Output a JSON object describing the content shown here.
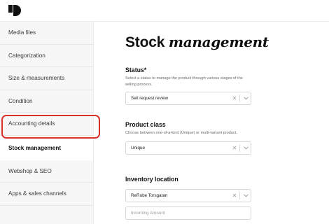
{
  "sidebar": {
    "items": [
      {
        "label": "Media files"
      },
      {
        "label": "Categorization"
      },
      {
        "label": "Size & measurements"
      },
      {
        "label": "Condition"
      },
      {
        "label": "Accounting details"
      },
      {
        "label": "Stock management"
      },
      {
        "label": "Webshop & SEO"
      },
      {
        "label": "Apps & sales channels"
      }
    ],
    "active_index": 5
  },
  "main": {
    "title_plain": "Stock",
    "title_italic": "management",
    "status": {
      "label": "Status*",
      "help": "Select a status to manage the product through various stages of the selling process.",
      "value": "Sell request review"
    },
    "product_class": {
      "label": "Product class",
      "help": "Choose between one-of-a-kind (Unique) or multi-variant product.",
      "value": "Unique"
    },
    "inventory_location": {
      "label": "Inventory location",
      "value": "ReRobe Torsgatan",
      "incoming_placeholder": "Incoming Amount"
    }
  },
  "colors": {
    "highlight": "#d9322c",
    "sidebar_bg": "#f7f7f7",
    "border": "#d7d7d7"
  },
  "icons": {
    "logo": "brand-logo",
    "clear": "close-icon",
    "dropdown": "chevron-down-icon"
  }
}
